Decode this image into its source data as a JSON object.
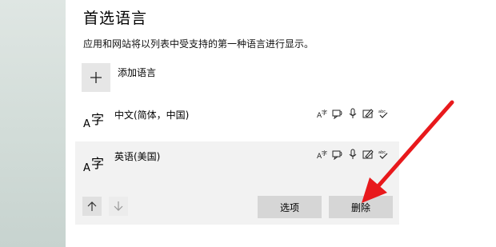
{
  "page": {
    "title": "首选语言",
    "description": "应用和网站将以列表中受支持的第一种语言进行显示。"
  },
  "add_language": {
    "label": "添加语言",
    "icon": "plus-icon"
  },
  "languages": [
    {
      "name": "中文(简体，中国)",
      "glyph": "字",
      "glyph_prefix": "A",
      "selected": false,
      "features": [
        "display-language-icon",
        "text-to-speech-icon",
        "speech-recognition-icon",
        "handwriting-icon",
        "spell-check-icon"
      ]
    },
    {
      "name": "英语(美国)",
      "glyph": "字",
      "glyph_prefix": "A",
      "selected": true,
      "features": [
        "display-language-icon",
        "text-to-speech-icon",
        "speech-recognition-icon",
        "handwriting-icon",
        "spell-check-icon"
      ]
    }
  ],
  "actions": {
    "move_up_icon": "arrow-up-icon",
    "move_down_icon": "arrow-down-icon",
    "options_label": "选项",
    "remove_label": "删除"
  },
  "colors": {
    "annotation_arrow": "#e8191c",
    "selected_row_bg": "#f2f2f2",
    "button_bg": "#d6d6d6"
  }
}
